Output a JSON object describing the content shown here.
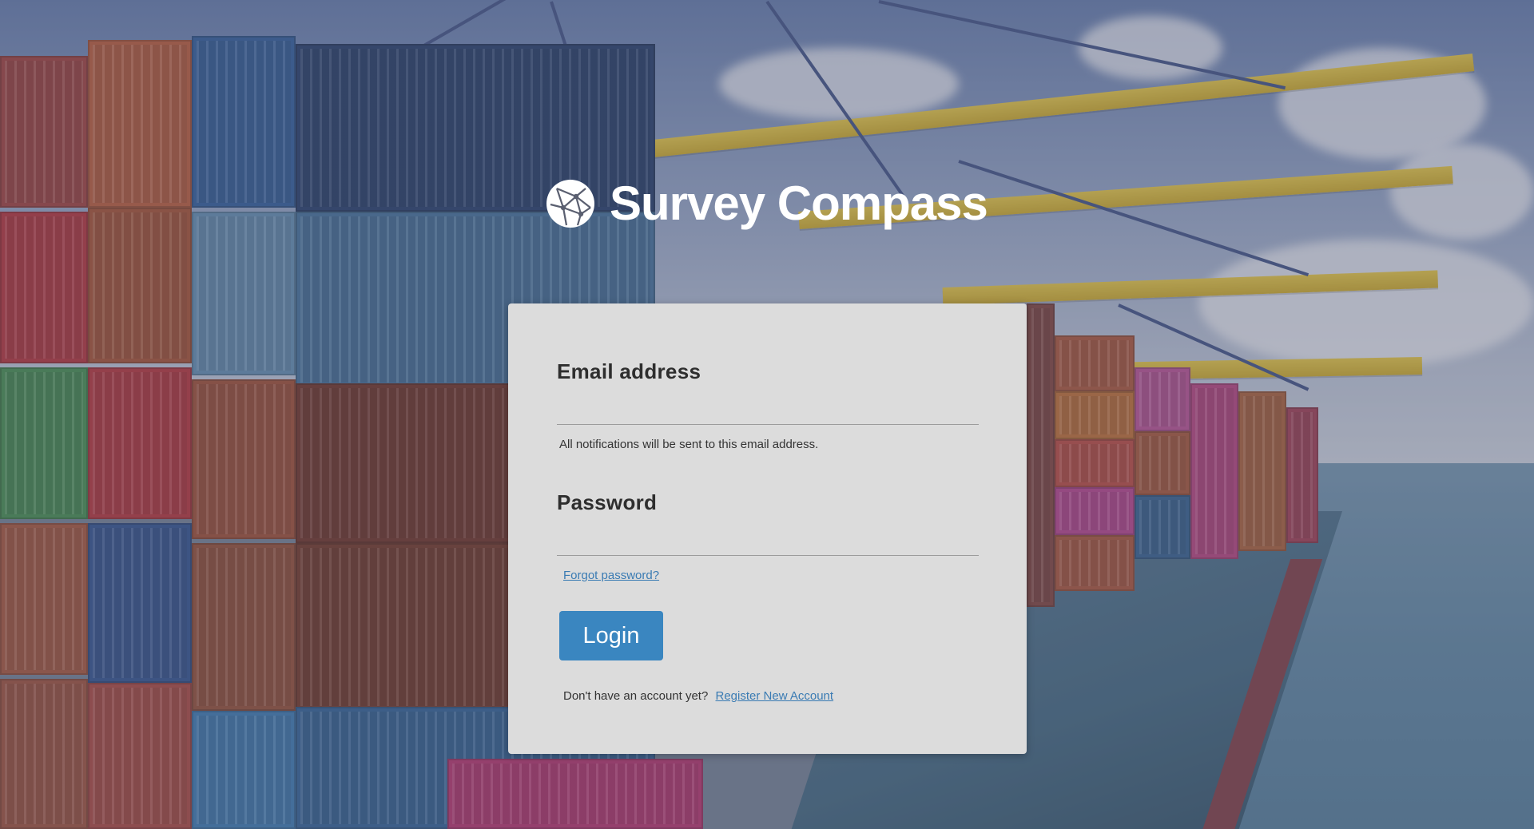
{
  "brand": {
    "name": "Survey Compass"
  },
  "login_form": {
    "email_label": "Email address",
    "email_value": "",
    "email_hint": "All notifications will be sent to this email address.",
    "password_label": "Password",
    "password_value": "",
    "forgot_password_link": "Forgot password?",
    "login_button": "Login",
    "register_prompt": "Don't have an account yet?",
    "register_link": "Register New Account"
  },
  "colors": {
    "card_background": "#dcdcdc",
    "primary_button": "#3a86c0",
    "link": "#3a7bb3"
  },
  "icons": {
    "logo": "globe-network-icon"
  }
}
